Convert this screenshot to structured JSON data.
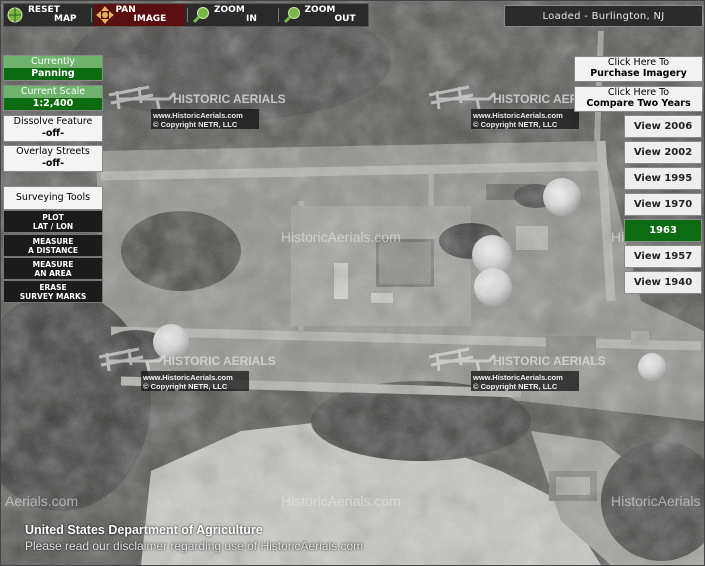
{
  "toolbar": {
    "reset": {
      "line1": "RESET",
      "line2": "MAP"
    },
    "pan": {
      "line1": "PAN",
      "line2": "IMAGE"
    },
    "zoom_in": {
      "line1": "ZOOM",
      "line2": "IN"
    },
    "zoom_out": {
      "line1": "ZOOM",
      "line2": "OUT"
    }
  },
  "status": {
    "loaded": "Loaded - Burlington, NJ"
  },
  "left_panel": {
    "currently": {
      "label": "Currently",
      "value": "Panning"
    },
    "scale": {
      "label": "Current Scale",
      "value": "1:2,400"
    },
    "dissolve": {
      "label": "Dissolve Feature",
      "value": "-off-"
    },
    "overlay": {
      "label": "Overlay Streets",
      "value": "-off-"
    },
    "surveying": {
      "label": "Surveying Tools"
    },
    "tools": [
      {
        "line1": "PLOT",
        "line2": "LAT / LON"
      },
      {
        "line1": "MEASURE",
        "line2": "A DISTANCE"
      },
      {
        "line1": "MEASURE",
        "line2": "AN AREA"
      },
      {
        "line1": "ERASE",
        "line2": "SURVEY MARKS"
      }
    ]
  },
  "right_panel": {
    "purchase": {
      "line1": "Click Here To",
      "line2": "Purchase Imagery"
    },
    "compare": {
      "line1": "Click Here To",
      "line2": "Compare Two Years"
    },
    "years": [
      "View 2006",
      "View 2002",
      "View 1995",
      "View 1970",
      "1963",
      "View 1957",
      "View 1940"
    ],
    "active_year": "1963"
  },
  "watermark": {
    "brand": "HISTORIC AERIALS",
    "url": "www.HistoricAerials.com",
    "copyright": "© Copyright NETR, LLC",
    "center": "HistoricAerials.com",
    "edge_left": "Aerials.com",
    "edge_right": "HistoricAerials"
  },
  "footer": {
    "agency": "United States Department of Agriculture",
    "disclaimer": "Please read our disclaimer regarding use of HistoricAerials.com"
  },
  "colors": {
    "active_green": "#0d6c12",
    "header_green": "#6fb36f",
    "toolbar_bg": "#2a2a2a"
  }
}
